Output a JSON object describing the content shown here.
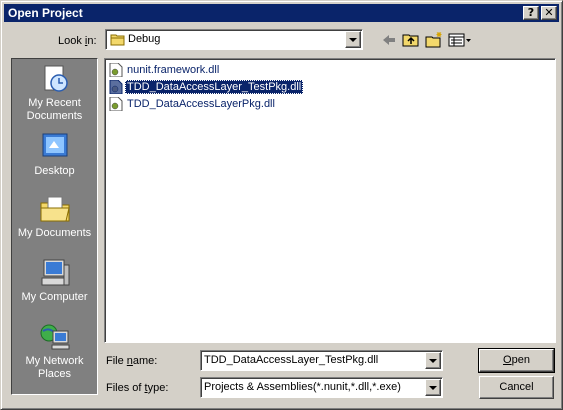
{
  "window": {
    "title": "Open Project",
    "help_glyph": "?",
    "close_glyph": "✕"
  },
  "lookin": {
    "label": "Look in:",
    "value": "Debug"
  },
  "toolbar": {
    "back_icon": "back-arrow-icon",
    "up_icon": "up-folder-icon",
    "new_folder_icon": "new-folder-icon",
    "views_icon": "views-menu-icon"
  },
  "places": [
    {
      "label": "My Recent Documents",
      "icon": "recent-documents-icon"
    },
    {
      "label": "Desktop",
      "icon": "desktop-icon"
    },
    {
      "label": "My Documents",
      "icon": "my-documents-icon"
    },
    {
      "label": "My Computer",
      "icon": "my-computer-icon"
    },
    {
      "label": "My Network Places",
      "icon": "network-places-icon"
    }
  ],
  "files": [
    {
      "name": "nunit.framework.dll",
      "selected": false
    },
    {
      "name": "TDD_DataAccessLayer_TestPkg.dll",
      "selected": true
    },
    {
      "name": "TDD_DataAccessLayerPkg.dll",
      "selected": false
    }
  ],
  "filename": {
    "label": "File name:",
    "value": "TDD_DataAccessLayer_TestPkg.dll"
  },
  "filetype": {
    "label": "Files of type:",
    "value": "Projects & Assemblies(*.nunit,*.dll,*.exe)"
  },
  "buttons": {
    "open": "Open",
    "cancel": "Cancel"
  },
  "colors": {
    "titlebar": "#0a246a",
    "face": "#d4d0c8",
    "places_bg": "#808080",
    "selection": "#0a246a"
  }
}
